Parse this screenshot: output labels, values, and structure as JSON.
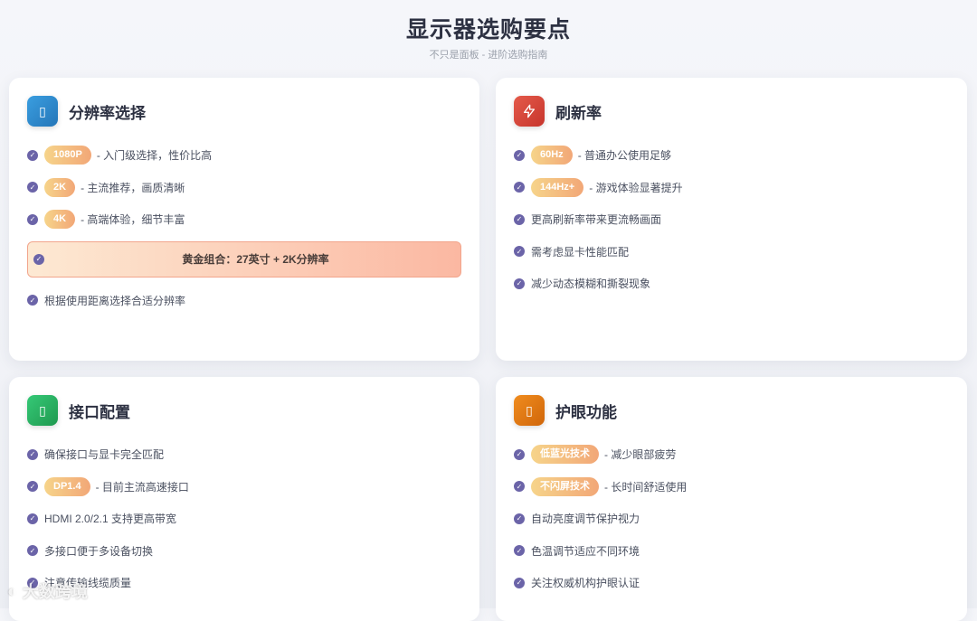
{
  "header": {
    "title": "显示器选购要点",
    "subtitle": "不只是面板 - 进阶选购指南"
  },
  "cards": {
    "resolution": {
      "title": "分辨率选择",
      "icon": "monitor-icon",
      "icon_glyph": "▯",
      "items": [
        {
          "tag": "1080P",
          "text": "- 入门级选择，性价比高"
        },
        {
          "tag": "2K",
          "text": "- 主流推荐，画质清晰"
        },
        {
          "tag": "4K",
          "text": "- 高端体验，细节丰富"
        }
      ],
      "highlight": "黄金组合：27英寸 + 2K分辨率",
      "footer_item": "根据使用距离选择合适分辨率"
    },
    "refresh": {
      "title": "刷新率",
      "icon": "lightning-icon",
      "items": [
        {
          "tag": "60Hz",
          "text": "- 普通办公使用足够"
        },
        {
          "tag": "144Hz+",
          "text": "- 游戏体验显著提升"
        },
        {
          "text": "更高刷新率带来更流畅画面"
        },
        {
          "text": "需考虑显卡性能匹配"
        },
        {
          "text": "减少动态模糊和撕裂现象"
        }
      ]
    },
    "ports": {
      "title": "接口配置",
      "icon": "port-icon",
      "icon_glyph": "▯",
      "items": [
        {
          "text": "确保接口与显卡完全匹配"
        },
        {
          "tag": "DP1.4",
          "text": "- 目前主流高速接口"
        },
        {
          "text": "HDMI 2.0/2.1 支持更高带宽"
        },
        {
          "text": "多接口便于多设备切换"
        },
        {
          "text": "注意传输线缆质量"
        }
      ]
    },
    "eyecare": {
      "title": "护眼功能",
      "icon": "eye-icon",
      "icon_glyph": "▯",
      "items": [
        {
          "tag": "低蓝光技术",
          "text": "- 减少眼部疲劳"
        },
        {
          "tag": "不闪屏技术",
          "text": "- 长时间舒适使用"
        },
        {
          "text": "自动亮度调节保护视力"
        },
        {
          "text": "色温调节适应不同环境"
        },
        {
          "text": "关注权威机构护眼认证"
        }
      ]
    }
  },
  "colors": {
    "resolution_icon": "#2f8fd3",
    "refresh_icon": "#d9473a",
    "ports_icon": "#2db56a",
    "eyecare_icon": "#e87c12",
    "check": "#6b64a8"
  },
  "watermark": "大数跨境"
}
